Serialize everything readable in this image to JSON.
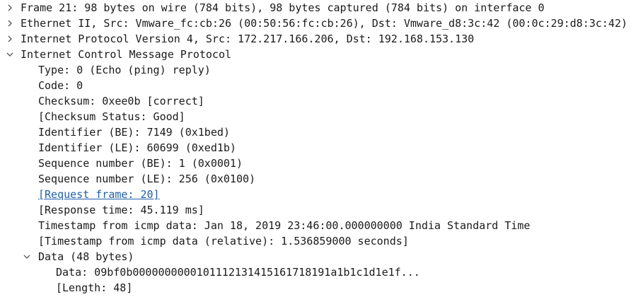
{
  "packet_details": {
    "frame": "Frame 21: 98 bytes on wire (784 bits), 98 bytes captured (784 bits) on interface 0",
    "ethernet": "Ethernet II, Src: Vmware_fc:cb:26 (00:50:56:fc:cb:26), Dst: Vmware_d8:3c:42 (00:0c:29:d8:3c:42)",
    "ip": "Internet Protocol Version 4, Src: 172.217.166.206, Dst: 192.168.153.130",
    "icmp": {
      "title": "Internet Control Message Protocol",
      "type": "Type: 0 (Echo (ping) reply)",
      "code": "Code: 0",
      "checksum": "Checksum: 0xee0b [correct]",
      "checksum_status": "[Checksum Status: Good]",
      "identifier_be": "Identifier (BE): 7149 (0x1bed)",
      "identifier_le": "Identifier (LE): 60699 (0xed1b)",
      "sequence_be": "Sequence number (BE): 1 (0x0001)",
      "sequence_le": "Sequence number (LE): 256 (0x0100)",
      "request_frame": "[Request frame: 20]",
      "response_time": "[Response time: 45.119 ms]",
      "timestamp": "Timestamp from icmp data: Jan 18, 2019 23:46:00.000000000 India Standard Time",
      "timestamp_relative": "[Timestamp from icmp data (relative): 1.536859000 seconds]",
      "data": {
        "title": "Data (48 bytes)",
        "data": "Data: 09bf0b0000000000101112131415161718191a1b1c1d1e1f...",
        "length": "[Length: 48]"
      }
    }
  },
  "colors": {
    "link": "#1f5ea8",
    "text": "#1a1a1a",
    "arrow": "#555555"
  }
}
